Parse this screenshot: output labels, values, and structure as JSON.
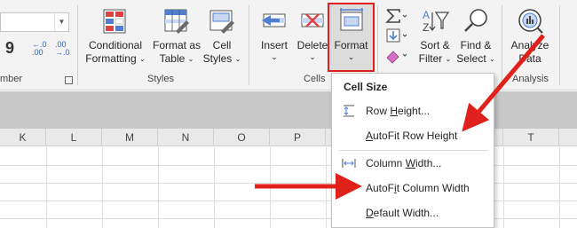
{
  "ribbon": {
    "number_group": {
      "label": "mber",
      "comma_glyph": "9",
      "increase_decimal": {
        "top": "←.0",
        "bottom": ".00"
      },
      "decrease_decimal": {
        "top": ".00",
        "bottom": "→.0"
      }
    },
    "styles_group": {
      "label": "Styles",
      "conditional_formatting": {
        "line1": "Conditional",
        "line2": "Formatting"
      },
      "format_as_table": {
        "line1": "Format as",
        "line2": "Table"
      },
      "cell_styles": {
        "line1": "Cell",
        "line2": "Styles"
      }
    },
    "cells_group": {
      "label": "Cells",
      "insert": "Insert",
      "delete": "Delete",
      "format": "Format"
    },
    "editing_group": {
      "sort_filter": {
        "line1": "Sort &",
        "line2": "Filter"
      },
      "find_select": {
        "line1": "Find &",
        "line2": "Select"
      }
    },
    "analysis_group": {
      "label": "Analysis",
      "analyze_data": {
        "line1": "Analyze",
        "line2": "Data"
      }
    }
  },
  "columns": [
    "K",
    "L",
    "M",
    "N",
    "O",
    "P",
    "T"
  ],
  "format_menu": {
    "header": "Cell Size",
    "row_height": {
      "pre": "Row ",
      "key": "H",
      "post": "eight..."
    },
    "autofit_row_height": {
      "pre": "",
      "key": "A",
      "post": "utoFit Row Height"
    },
    "column_width": {
      "pre": "Column ",
      "key": "W",
      "post": "idth..."
    },
    "autofit_column_width": {
      "pre": "AutoF",
      "key": "i",
      "post": "t Column Width"
    },
    "default_width": {
      "pre": "",
      "key": "D",
      "post": "efault Width..."
    }
  },
  "colors": {
    "highlight_border": "#e0201b",
    "annotation_arrow": "#e0201b",
    "ribbon_bg": "#f3f3f3"
  }
}
